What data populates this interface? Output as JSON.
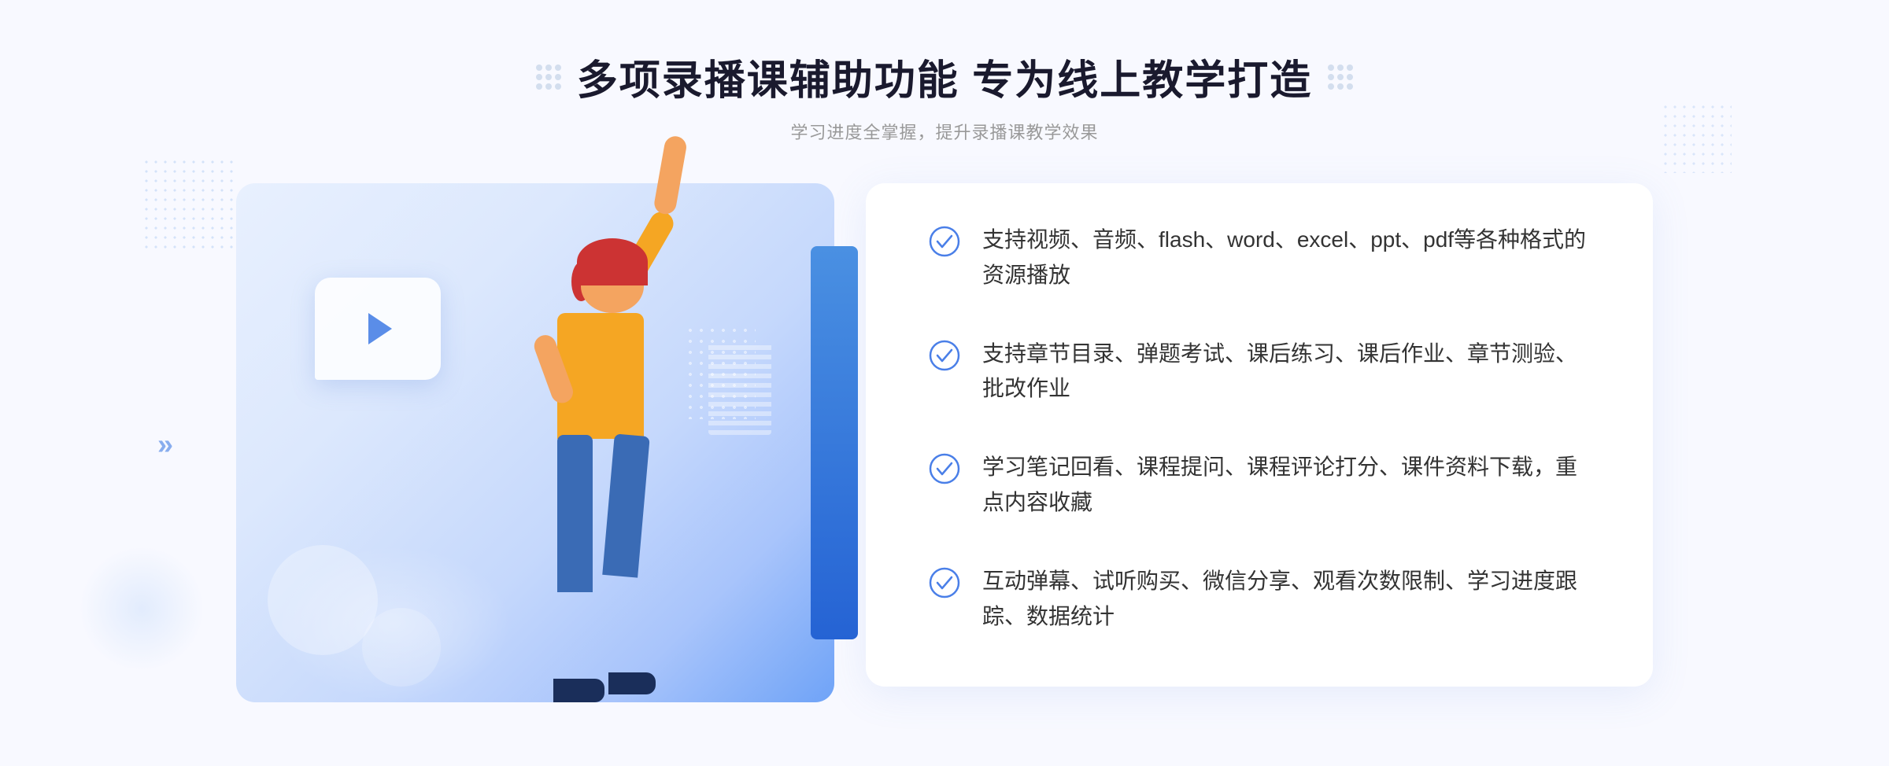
{
  "header": {
    "main_title": "多项录播课辅助功能 专为线上教学打造",
    "sub_title": "学习进度全掌握，提升录播课教学效果"
  },
  "features": [
    {
      "id": "feature1",
      "text": "支持视频、音频、flash、word、excel、ppt、pdf等各种格式的资源播放"
    },
    {
      "id": "feature2",
      "text": "支持章节目录、弹题考试、课后练习、课后作业、章节测验、批改作业"
    },
    {
      "id": "feature3",
      "text": "学习笔记回看、课程提问、课程评论打分、课件资料下载，重点内容收藏"
    },
    {
      "id": "feature4",
      "text": "互动弹幕、试听购买、微信分享、观看次数限制、学习进度跟踪、数据统计"
    }
  ],
  "colors": {
    "accent_blue": "#4a7fe8",
    "text_dark": "#333333",
    "text_gray": "#999999",
    "bg_light": "#f8f9ff",
    "check_color": "#4a7fe8"
  },
  "icons": {
    "check": "check-circle",
    "play": "play-triangle",
    "dots_decoration": "grid-dots",
    "arrow_double": "chevron-double"
  }
}
